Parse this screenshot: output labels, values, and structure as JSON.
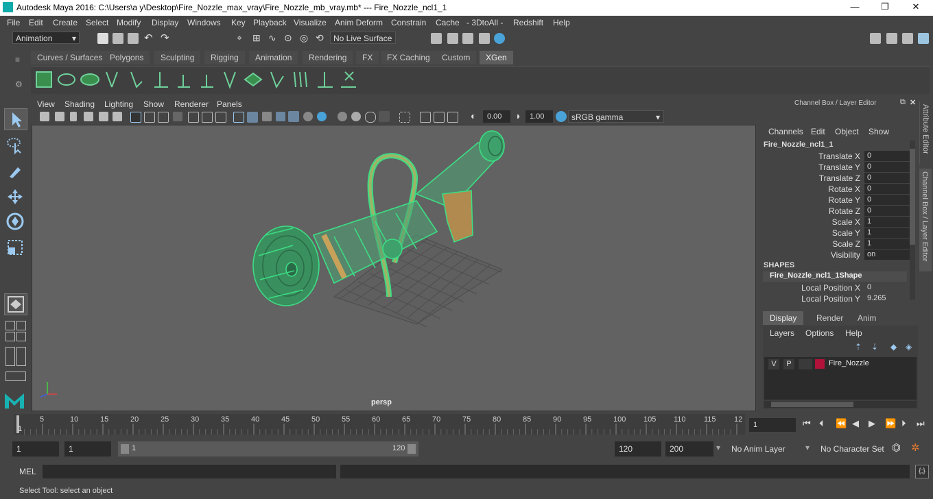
{
  "window": {
    "title": "Autodesk Maya 2016: C:\\Users\\a y\\Desktop\\Fire_Nozzle_max_vray\\Fire_Nozzle_mb_vray.mb*   ---   Fire_Nozzle_ncl1_1",
    "minimize": "—",
    "maximize": "❐",
    "close": "✕"
  },
  "menu": [
    "File",
    "Edit",
    "Create",
    "Select",
    "Modify",
    "Display",
    "Windows",
    "Key",
    "Playback",
    "Visualize",
    "Anim Deform",
    "Constrain",
    "Cache",
    "- 3DtoAll -",
    "Redshift",
    "Help"
  ],
  "status": {
    "menuset": "Animation",
    "live_surface": "No Live Surface"
  },
  "shelf_tabs": [
    "Curves / Surfaces",
    "Polygons",
    "Sculpting",
    "Rigging",
    "Animation",
    "Rendering",
    "FX",
    "FX Caching",
    "Custom",
    "XGen"
  ],
  "shelf_active": "XGen",
  "viewport": {
    "menu": [
      "View",
      "Shading",
      "Lighting",
      "Show",
      "Renderer",
      "Panels"
    ],
    "exposure": "0.00",
    "gamma": "1.00",
    "color_space": "sRGB gamma",
    "camera_label": "persp"
  },
  "channel_box": {
    "header": "Channel Box / Layer Editor",
    "menu": [
      "Channels",
      "Edit",
      "Object",
      "Show"
    ],
    "object": "Fire_Nozzle_ncl1_1",
    "channels": [
      {
        "label": "Translate X",
        "value": "0"
      },
      {
        "label": "Translate Y",
        "value": "0"
      },
      {
        "label": "Translate Z",
        "value": "0"
      },
      {
        "label": "Rotate X",
        "value": "0"
      },
      {
        "label": "Rotate Y",
        "value": "0"
      },
      {
        "label": "Rotate Z",
        "value": "0"
      },
      {
        "label": "Scale X",
        "value": "1"
      },
      {
        "label": "Scale Y",
        "value": "1"
      },
      {
        "label": "Scale Z",
        "value": "1"
      },
      {
        "label": "Visibility",
        "value": "on"
      }
    ],
    "shapes_header": "SHAPES",
    "shape_name": "Fire_Nozzle_ncl1_1Shape",
    "shape_channels": [
      {
        "label": "Local Position X",
        "value": "0"
      },
      {
        "label": "Local Position Y",
        "value": "9.265"
      }
    ]
  },
  "layer_editor": {
    "tabs": [
      "Display",
      "Render",
      "Anim"
    ],
    "menu": [
      "Layers",
      "Options",
      "Help"
    ],
    "layer": {
      "v": "V",
      "p": "P",
      "name": "Fire_Nozzle",
      "color": "#b0123a"
    }
  },
  "side_tabs": {
    "attribute_editor": "Attribute Editor",
    "channel_box": "Channel Box / Layer Editor"
  },
  "timeline": {
    "ticks": [
      "5",
      "10",
      "15",
      "20",
      "25",
      "30",
      "35",
      "40",
      "45",
      "50",
      "55",
      "60",
      "65",
      "70",
      "75",
      "80",
      "85",
      "90",
      "95",
      "100",
      "105",
      "110",
      "115",
      "12"
    ],
    "current_frame": "1",
    "current_frame_field": "1"
  },
  "range": {
    "start": "1",
    "start2": "1",
    "slider_start": "1",
    "slider_end": "120",
    "end": "120",
    "end2": "200",
    "anim_layer": "No Anim Layer",
    "character_set": "No Character Set"
  },
  "command_line": {
    "label": "MEL"
  },
  "help_line": "Select Tool: select an object",
  "colors": {
    "wire": "#3ddc84",
    "accent": "#5d5d5d"
  }
}
